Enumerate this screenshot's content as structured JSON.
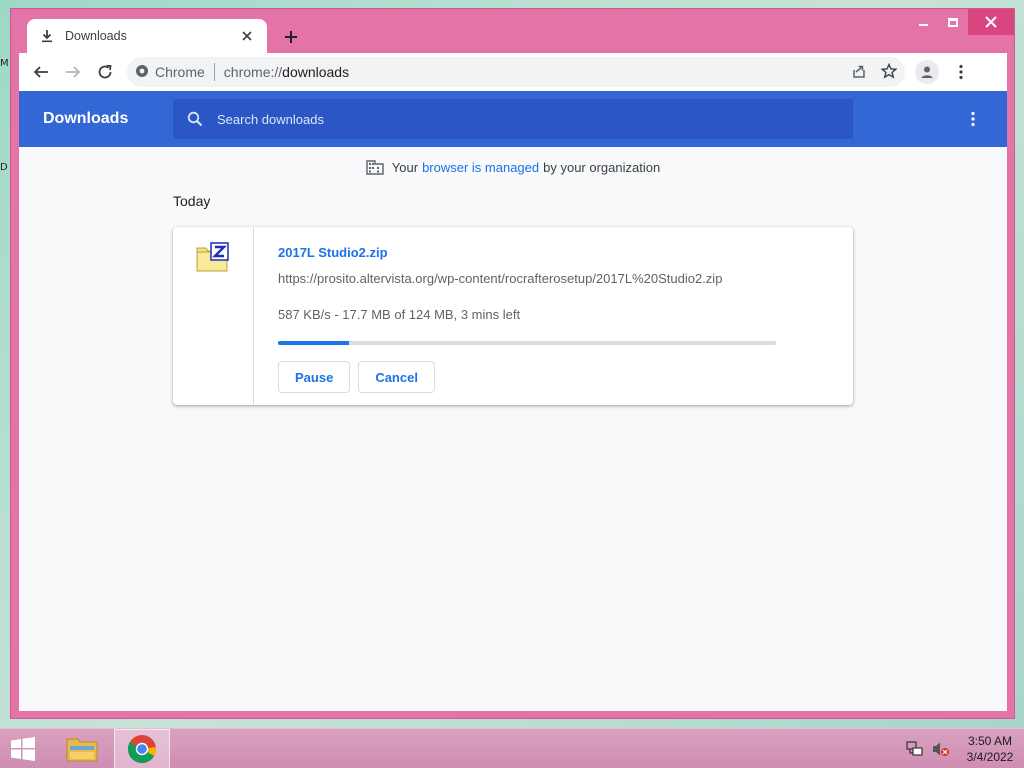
{
  "desktop": {
    "edge_labels": [
      "M",
      "D"
    ]
  },
  "window": {
    "controls": {
      "minimize": "minimize-icon",
      "maximize": "maximize-icon",
      "close": "close-icon"
    }
  },
  "tab": {
    "title": "Downloads",
    "close_icon": "close-icon"
  },
  "toolbar": {
    "omnibox_site_label": "Chrome",
    "url_scheme": "chrome://",
    "url_path": "downloads"
  },
  "downloads_page": {
    "title": "Downloads",
    "search_placeholder": "Search downloads",
    "managed_notice": {
      "prefix": "Your",
      "link": "browser is managed",
      "suffix": "by your organization"
    },
    "section_date": "Today",
    "items": [
      {
        "file_name": "2017L Studio2.zip",
        "url": "https://prosito.altervista.org/wp-content/rocrafterosetup/2017L%20Studio2.zip",
        "status": "587 KB/s - 17.7 MB of 124 MB, 3 mins left",
        "progress_fraction": 0.142,
        "pause_label": "Pause",
        "cancel_label": "Cancel"
      }
    ]
  },
  "colors": {
    "window_frame": "#e474a8",
    "header_blue": "#3367d6",
    "accent": "#1a73e8"
  },
  "taskbar": {
    "time": "3:50 AM",
    "date": "3/4/2022"
  }
}
